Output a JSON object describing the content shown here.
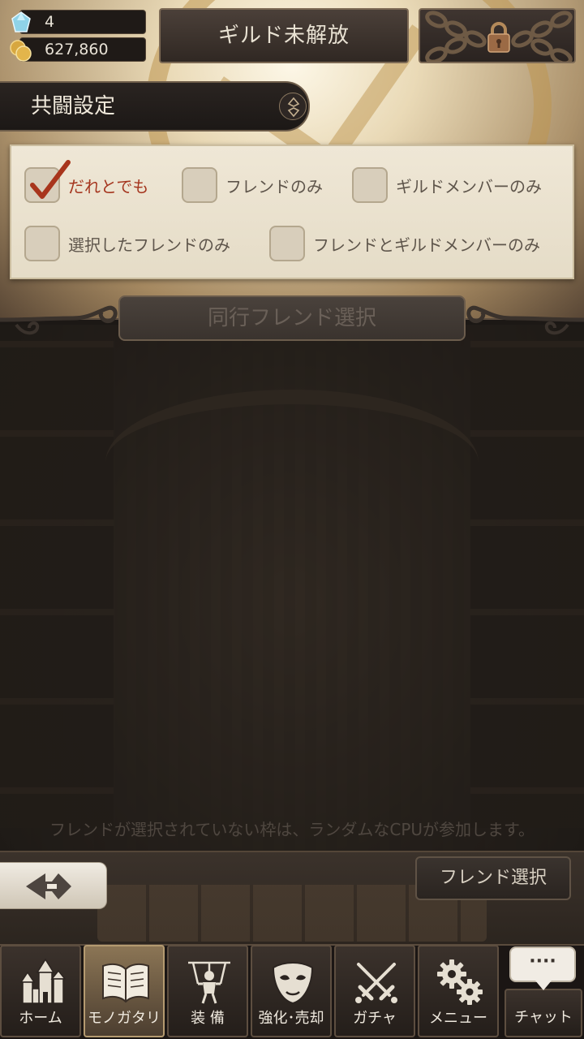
{
  "resources": {
    "gems": "4",
    "coins": "627,860"
  },
  "header": {
    "guild_label": "ギルド未解放"
  },
  "coop": {
    "title": "共闘設定",
    "options": [
      {
        "label": "だれとでも",
        "selected": true
      },
      {
        "label": "フレンドのみ",
        "selected": false
      },
      {
        "label": "ギルドメンバーのみ",
        "selected": false
      },
      {
        "label": "選択したフレンドのみ",
        "selected": false
      },
      {
        "label": "フレンドとギルドメンバーのみ",
        "selected": false
      }
    ]
  },
  "section": {
    "title": "同行フレンド選択",
    "notice": "フレンドが選択されていない枠は、ランダムなCPUが参加します。"
  },
  "actions": {
    "friend_select": "フレンド選択"
  },
  "nav": {
    "items": [
      {
        "label": "ホーム",
        "icon": "castle-icon",
        "active": false
      },
      {
        "label": "モノガタリ",
        "icon": "book-icon",
        "active": true
      },
      {
        "label": "装 備",
        "icon": "puppet-icon",
        "active": false
      },
      {
        "label": "強化･売却",
        "icon": "mask-icon",
        "active": false
      },
      {
        "label": "ガチャ",
        "icon": "swords-icon",
        "active": false
      },
      {
        "label": "メニュー",
        "icon": "gears-icon",
        "active": false
      }
    ],
    "chat_bubble": "····",
    "chat_label": "チャット"
  },
  "colors": {
    "selected_text": "#a5361f",
    "parchment": "#efe7d6"
  }
}
